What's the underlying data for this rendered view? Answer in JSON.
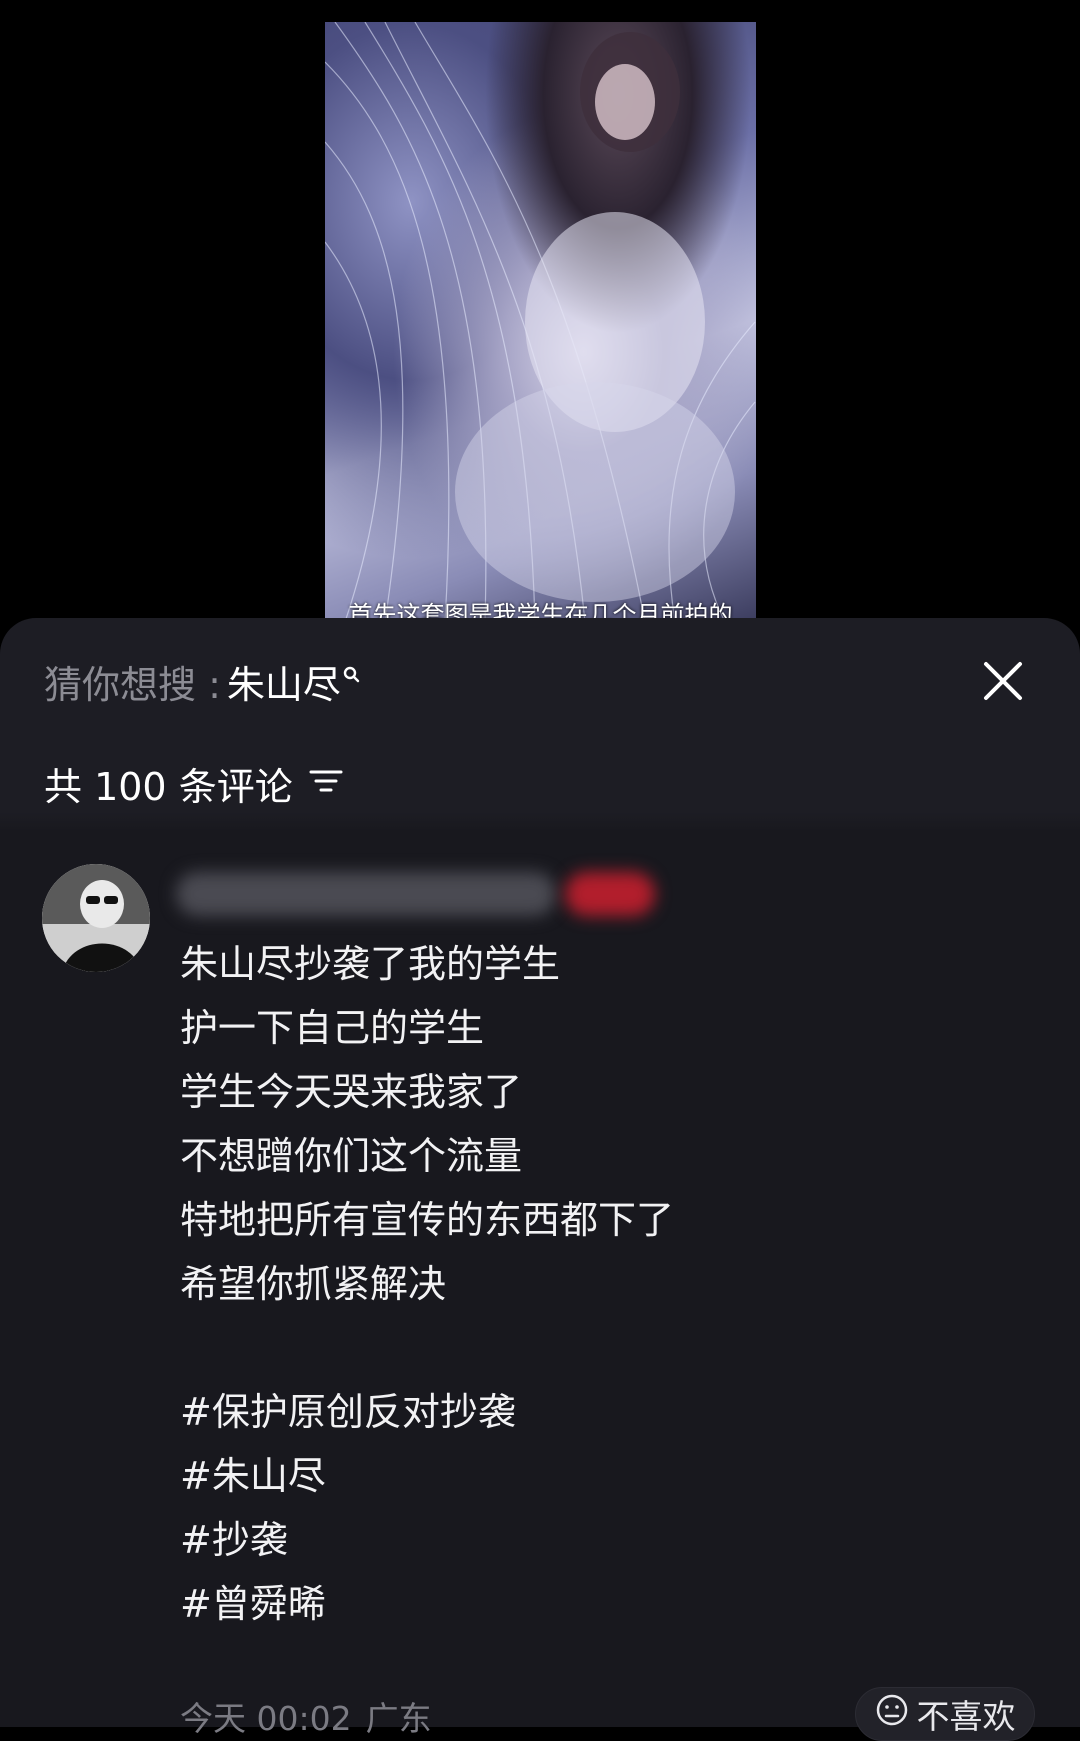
{
  "video": {
    "caption": "首先这套图是我学生在几个月前拍的"
  },
  "sheet": {
    "search_prefix": "猜你想搜 :",
    "search_term": "朱山尽",
    "comments_count_label": "共 100 条评论",
    "icons": [
      "search-icon",
      "close-icon",
      "sort-icon"
    ]
  },
  "comment": {
    "lines": [
      "朱山尽抄袭了我的学生",
      "护一下自己的学生",
      "学生今天哭来我家了",
      "不想蹭你们这个流量",
      "特地把所有宣传的东西都下了",
      "希望你抓紧解决",
      "",
      "#保护原创反对抄袭",
      "#朱山尽",
      "#抄袭",
      "#曾舜晞"
    ],
    "time": "今天 00:02",
    "location": "广东",
    "dislike_label": "不喜欢",
    "dislike_icon": "neutral-face-icon"
  }
}
